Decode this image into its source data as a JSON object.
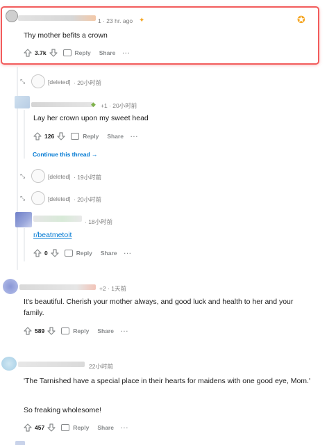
{
  "highlighted": {
    "meta": "1 · 23 hr. ago",
    "text": "Thy mother befits a crown",
    "votes": "3.7k",
    "reply": "Reply",
    "share": "Share",
    "more": "···"
  },
  "deleted1": {
    "name": "[deleted]",
    "time": "· 20小时前"
  },
  "lay": {
    "meta": "+1 · 20小时前",
    "text": "Lay her crown upon my sweet head",
    "votes": "126",
    "reply": "Reply",
    "share": "Share",
    "more": "···",
    "continue": "Continue this thread →"
  },
  "deleted2": {
    "name": "[deleted]",
    "time": "· 19小时前"
  },
  "deleted3": {
    "name": "[deleted]",
    "time": "· 20小时前"
  },
  "beat": {
    "meta": "· 18小时前",
    "link": "r/beatmetoit",
    "votes": "0",
    "reply": "Reply",
    "share": "Share",
    "more": "···"
  },
  "beautiful": {
    "meta": "+2 · 1天前",
    "text": "It's beautiful. Cherish your mother always, and good luck and health to her and your family.",
    "votes": "589",
    "reply": "Reply",
    "share": "Share",
    "more": "···"
  },
  "tarnished": {
    "meta": "22小时前",
    "text1": "'The Tarnished have a special place in their hearts for maidens with one good eye, Mom.'",
    "text2": "So freaking wholesome!",
    "votes": "457",
    "reply": "Reply",
    "share": "Share",
    "more": "···"
  },
  "colors": {
    "highlight_border": "#f25c5c",
    "link": "#0079d3",
    "meta": "#7c7c7c"
  },
  "icons": [
    "upvote-icon",
    "downvote-icon",
    "comment-icon",
    "award-icon",
    "expand-icon"
  ]
}
